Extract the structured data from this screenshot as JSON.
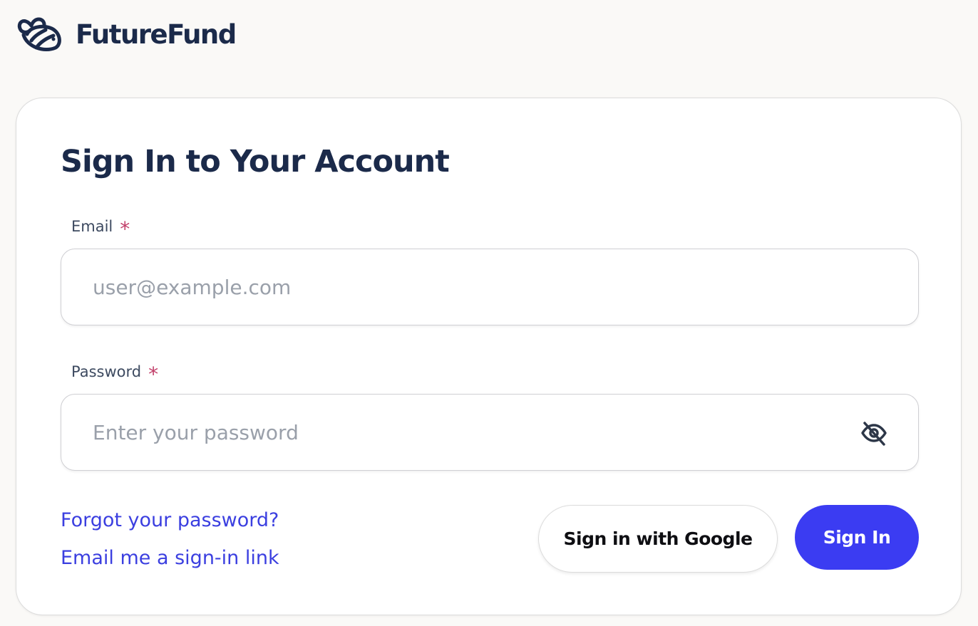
{
  "brand": {
    "name": "FutureFund",
    "logo_icon": "bee-icon"
  },
  "form": {
    "title": "Sign In to Your Account",
    "email": {
      "label": "Email",
      "required_mark": "*",
      "placeholder": "user@example.com",
      "value": ""
    },
    "password": {
      "label": "Password",
      "required_mark": "*",
      "placeholder": "Enter your password",
      "value": "",
      "toggle_icon": "eye-off-icon"
    },
    "links": {
      "forgot": "Forgot your password?",
      "magic_link": "Email me a sign-in link"
    },
    "buttons": {
      "google": "Sign in with Google",
      "sign_in": "Sign In"
    }
  },
  "colors": {
    "primary": "#3b3cf2",
    "link": "#3b3fe0",
    "heading": "#1b2a4a",
    "required": "#c2406a",
    "background": "#faf9f7"
  }
}
